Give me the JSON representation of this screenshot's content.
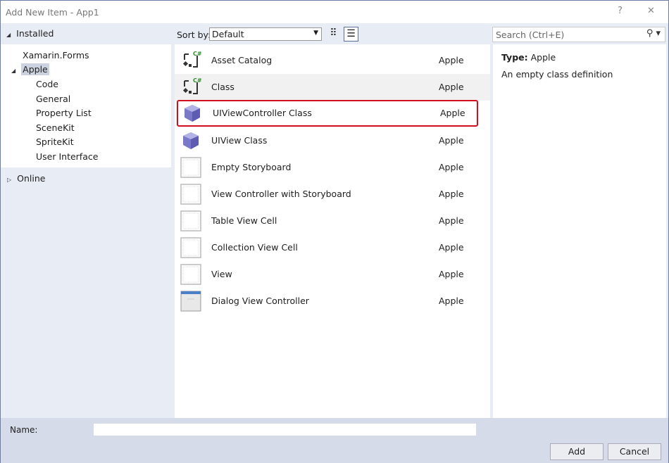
{
  "window": {
    "title": "Add New Item - App1",
    "help": "?",
    "close": "✕"
  },
  "left": {
    "installed": "Installed",
    "online": "Online",
    "tree": [
      {
        "label": "Xamarin.Forms"
      },
      {
        "label": "Apple"
      },
      {
        "label": "Code"
      },
      {
        "label": "General"
      },
      {
        "label": "Property List"
      },
      {
        "label": "SceneKit"
      },
      {
        "label": "SpriteKit"
      },
      {
        "label": "User Interface"
      }
    ]
  },
  "toolbar": {
    "sort_label": "Sort by:",
    "sort_value": "Default"
  },
  "templates": [
    {
      "name": "Asset Catalog",
      "type": "Apple",
      "icon": "csharp-class"
    },
    {
      "name": "Class",
      "type": "Apple",
      "icon": "csharp-class"
    },
    {
      "name": "UIViewController Class",
      "type": "Apple",
      "icon": "cube"
    },
    {
      "name": "UIView Class",
      "type": "Apple",
      "icon": "cube"
    },
    {
      "name": "Empty Storyboard",
      "type": "Apple",
      "icon": "storyboard"
    },
    {
      "name": "View Controller with Storyboard",
      "type": "Apple",
      "icon": "storyboard"
    },
    {
      "name": "Table View Cell",
      "type": "Apple",
      "icon": "storyboard"
    },
    {
      "name": "Collection View Cell",
      "type": "Apple",
      "icon": "storyboard"
    },
    {
      "name": "View",
      "type": "Apple",
      "icon": "storyboard"
    },
    {
      "name": "Dialog View Controller",
      "type": "Apple",
      "icon": "dialog"
    }
  ],
  "search": {
    "placeholder": "Search (Ctrl+E)"
  },
  "details": {
    "type_label": "Type:",
    "type_value": "Apple",
    "description": "An empty class definition"
  },
  "footer": {
    "name_label": "Name:",
    "name_value": "",
    "add": "Add",
    "cancel": "Cancel"
  },
  "colors": {
    "highlight_border": "#d0101e",
    "panel_bg": "#e8ecf5",
    "footer_bg": "#d6dbe9"
  }
}
